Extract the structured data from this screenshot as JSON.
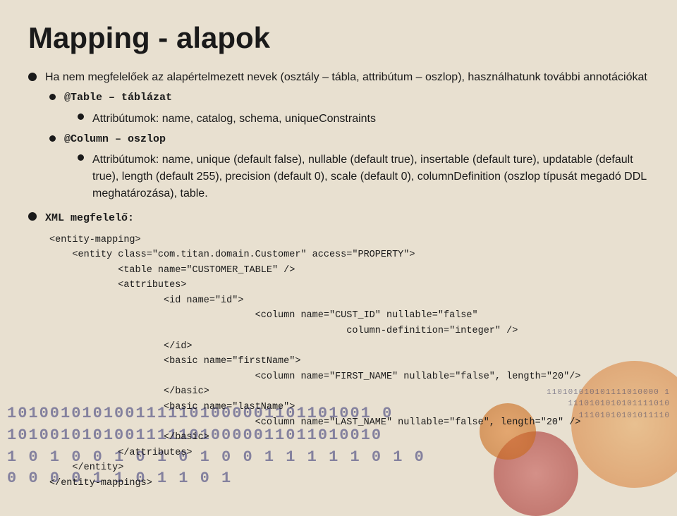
{
  "page": {
    "title": "Mapping - alapok",
    "background_color": "#e8e0d0"
  },
  "content": {
    "title": "Mapping - alapok",
    "intro_bullet": {
      "text": "Ha nem megfelelőek az alapértelmezett nevek (osztály – tábla, attribútum – oszlop), használhatunk további annotációkat"
    },
    "table_annotation": {
      "label": "@Table – táblázat",
      "sub_bullet": "Attribútumok: name, catalog, schema, uniqueConstraints"
    },
    "column_annotation": {
      "label": "@Column – oszlop",
      "sub_bullet": "Attribútumok: name, unique (default false), nullable (default true), insertable (default ture), updatable (default true), length (default 255), precision (default 0), scale (default 0), columnDefinition (oszlop típusát megadó DDL meghatározása), table."
    },
    "xml_section": {
      "label": "XML megfelelő:",
      "lines": [
        "<entity-mapping>",
        "    <entity class=\"com.titan.domain.Customer\" access=\"PROPERTY\">",
        "            <table name=\"CUSTOMER_TABLE\" />",
        "            <attributes>",
        "                    <id name=\"id\">",
        "                                    <column name=\"CUST_ID\" nullable=\"false\"",
        "                                                    column-definition=\"integer\" />",
        "                    </id>",
        "                    <basic name=\"firstName\">",
        "                                    <column name=\"FIRST_NAME\" nullable=\"false\", length=\"20\"/>",
        "                    </basic>",
        "                    <basic name=\"lastName\">",
        "                                    <column name=\"LAST_NAME\" nullable=\"false\", length=\"20\" />",
        "                    </basic>",
        "            </attributes>",
        "    </entity>",
        "</entity-mappings>"
      ]
    }
  },
  "binary_patterns": {
    "left_line1": "1010010101001111101000001101101001 0",
    "left_line2": "10100101010011111010000011011010010",
    "right_line1": "11101010101011110100000 1",
    "right_line2": "1110101010101111010 0001"
  },
  "decoration": {
    "circles": [
      "orange-large",
      "red-medium",
      "orange-small"
    ]
  }
}
